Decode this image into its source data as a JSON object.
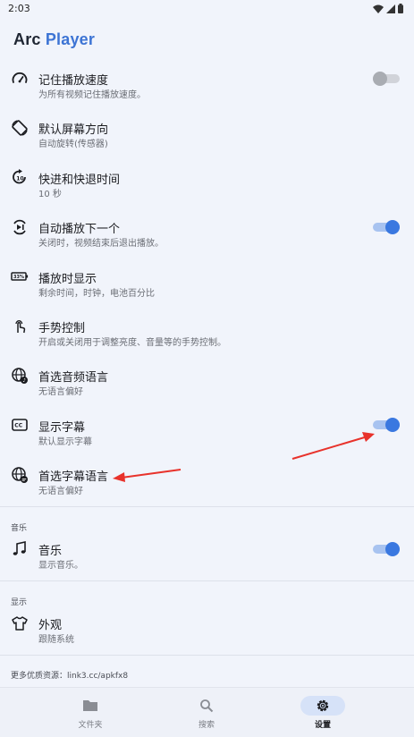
{
  "status_bar": {
    "time": "2:03"
  },
  "app": {
    "title_part1": "Arc",
    "title_part2": "Player"
  },
  "playback_settings": [
    {
      "title": "记住播放速度",
      "subtitle": "为所有视频记住播放速度。",
      "icon": "speedometer-icon",
      "toggle": false
    },
    {
      "title": "默认屏幕方向",
      "subtitle": "自动旋转(传感器)",
      "icon": "screen-rotation-icon"
    },
    {
      "title": "快进和快退时间",
      "subtitle": "10 秒",
      "icon": "forward-10-icon"
    },
    {
      "title": "自动播放下一个",
      "subtitle": "关闭时，视频结束后退出播放。",
      "icon": "autoplay-icon",
      "toggle": true
    },
    {
      "title": "播放时显示",
      "subtitle": "剩余时间，时钟，电池百分比",
      "icon": "battery-icon"
    },
    {
      "title": "手势控制",
      "subtitle": "开启或关闭用于调整亮度、音量等的手势控制。",
      "icon": "gesture-icon"
    },
    {
      "title": "首选音频语言",
      "subtitle": "无语言偏好",
      "icon": "globe-audio-icon"
    },
    {
      "title": "显示字幕",
      "subtitle": "默认显示字幕",
      "icon": "closed-caption-icon",
      "toggle": true
    },
    {
      "title": "首选字幕语言",
      "subtitle": "无语言偏好",
      "icon": "globe-subtitle-icon"
    }
  ],
  "music_section": {
    "label": "音乐",
    "item": {
      "title": "音乐",
      "subtitle": "显示音乐。",
      "icon": "music-note-icon",
      "toggle": true
    }
  },
  "display_section": {
    "label": "显示",
    "item": {
      "title": "外观",
      "subtitle": "跟随系统",
      "icon": "shirt-icon"
    }
  },
  "footer_note": "更多优质资源：link3.cc/apkfx8",
  "bottom_nav": [
    {
      "label": "文件夹",
      "icon": "folder-icon",
      "active": false
    },
    {
      "label": "搜索",
      "icon": "search-icon",
      "active": false
    },
    {
      "label": "设置",
      "icon": "gear-icon",
      "active": true
    }
  ],
  "colors": {
    "accent": "#3a78e0",
    "background": "#f1f4fb",
    "annotation_arrow": "#e8322b"
  }
}
